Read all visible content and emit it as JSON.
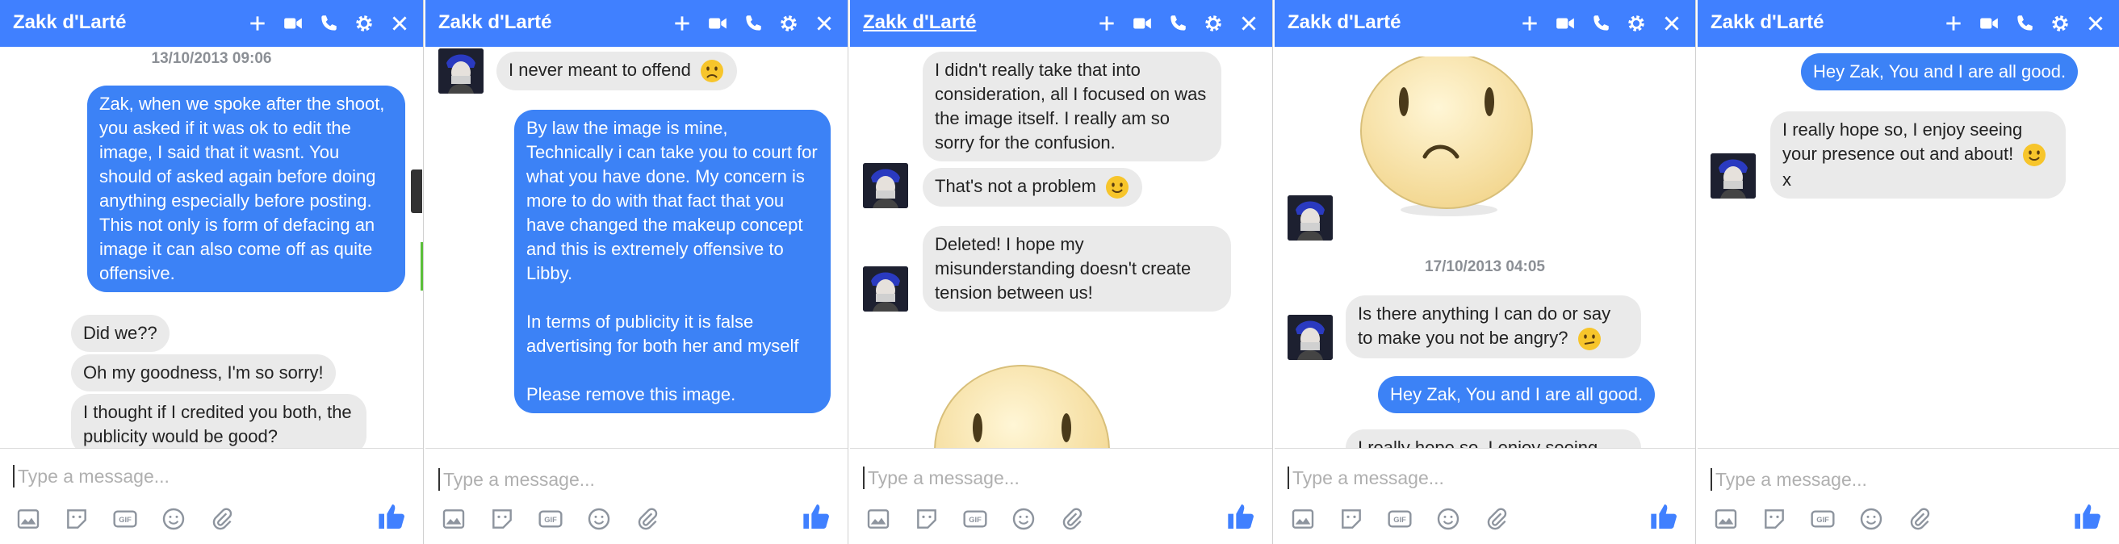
{
  "colors": {
    "header": "#4080ff",
    "outgoing": "#3c82f6",
    "incoming": "#eaeaea",
    "timestamp": "#8b8f95"
  },
  "icons": {
    "header": [
      "plus-icon",
      "video-icon",
      "phone-icon",
      "gear-icon",
      "close-icon"
    ],
    "tools": [
      "photo-icon",
      "sticker-icon",
      "gif-icon",
      "emoji-icon",
      "attach-icon"
    ],
    "send": "thumbs-up-icon"
  },
  "panels": [
    {
      "title": "Zakk d'Larté",
      "input_placeholder": "Type a message...",
      "timestamp": "13/10/2013 09:06",
      "messages": [
        "Zak, when we spoke after the shoot, you asked if it was ok to edit the image, I said that it wasnt. You should of asked again before doing anything especially before  posting. This not only is form of defacing an image it can also come off as quite offensive.",
        "Did we??",
        "Oh my goodness, I'm so sorry!",
        "I thought if I credited you both, the publicity would be good?"
      ]
    },
    {
      "title": "Zakk d'Larté",
      "input_placeholder": "Type a message...",
      "messages": [
        "I never meant to offend",
        "By law the image is mine, Technically i can take you to court for what you have done. My concern is more to do with that fact that you have changed the makeup concept and this is extremely offensive to Libby.\n\nIn terms of publicity it is false advertising for both her and myself\n\nPlease remove this image."
      ]
    },
    {
      "title": "Zakk d'Larté",
      "input_placeholder": "Type a message...",
      "messages": [
        "I didn't really take that into consideration, all I focused on was the image itself. I really am so sorry for the confusion.",
        "That's not a problem",
        "Deleted! I hope my misunderstanding doesn't create tension between us!"
      ]
    },
    {
      "title": "Zakk d'Larté",
      "input_placeholder": "Type a message...",
      "timestamp": "17/10/2013 04:05",
      "messages": [
        "Is there anything I can do or say to make you not be angry?",
        "Hey Zak, You and I are all good.",
        "I really hope so, I enjoy seeing"
      ]
    },
    {
      "title": "Zakk d'Larté",
      "input_placeholder": "Type a message...",
      "messages": [
        "Hey Zak, You and I are all good.",
        "I really hope so, I enjoy seeing your presence out and about!",
        "x"
      ]
    }
  ]
}
